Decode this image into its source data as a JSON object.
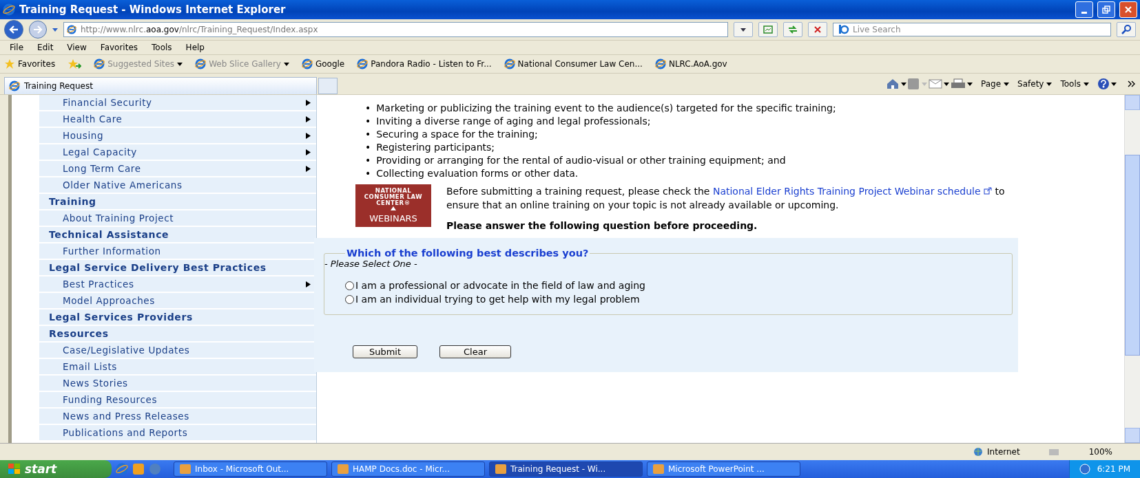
{
  "window": {
    "title": "Training Request - Windows Internet Explorer"
  },
  "address_bar": {
    "url": "http://www.nlrc.**aoa.gov**/nlrc/Training_Request/Index.aspx"
  },
  "search": {
    "placeholder": "Live Search"
  },
  "menu": [
    "File",
    "Edit",
    "View",
    "Favorites",
    "Tools",
    "Help"
  ],
  "favorites_bar": {
    "label": "Favorites",
    "links": [
      {
        "label": "Suggested Sites",
        "kind": "dropdown"
      },
      {
        "label": "Web Slice Gallery",
        "kind": "dropdown"
      },
      {
        "label": "Google",
        "kind": "link"
      },
      {
        "label": "Pandora Radio - Listen to Fr...",
        "kind": "link"
      },
      {
        "label": "National Consumer Law Cen...",
        "kind": "link"
      },
      {
        "label": "NLRC.AoA.gov",
        "kind": "link"
      }
    ]
  },
  "tabs": [
    {
      "label": "Training Request",
      "selected": true
    }
  ],
  "command_bar": [
    "Page",
    "Safety",
    "Tools"
  ],
  "sidebar": {
    "items": [
      {
        "label": "Financial Security",
        "kind": "sub",
        "submenu": true
      },
      {
        "label": "Health Care",
        "kind": "sub",
        "submenu": true
      },
      {
        "label": "Housing",
        "kind": "sub",
        "submenu": true
      },
      {
        "label": "Legal Capacity",
        "kind": "sub",
        "submenu": true
      },
      {
        "label": "Long Term Care",
        "kind": "sub",
        "submenu": true
      },
      {
        "label": "Older Native Americans",
        "kind": "sub",
        "submenu": false
      },
      {
        "label": "Training",
        "kind": "heading",
        "submenu": false
      },
      {
        "label": "About Training Project",
        "kind": "sub",
        "submenu": false
      },
      {
        "label": "Technical Assistance",
        "kind": "heading",
        "submenu": false
      },
      {
        "label": "Further Information",
        "kind": "sub",
        "submenu": false
      },
      {
        "label": "Legal Service Delivery Best Practices",
        "kind": "heading",
        "submenu": false
      },
      {
        "label": "Best Practices",
        "kind": "sub",
        "submenu": true
      },
      {
        "label": "Model Approaches",
        "kind": "sub",
        "submenu": false
      },
      {
        "label": "Legal Services Providers",
        "kind": "heading",
        "submenu": false
      },
      {
        "label": "Resources",
        "kind": "heading",
        "submenu": false
      },
      {
        "label": "Case/Legislative Updates",
        "kind": "sub",
        "submenu": false
      },
      {
        "label": "Email Lists",
        "kind": "sub",
        "submenu": false
      },
      {
        "label": "News Stories",
        "kind": "sub",
        "submenu": false
      },
      {
        "label": "Funding Resources",
        "kind": "sub",
        "submenu": false
      },
      {
        "label": "News and Press Releases",
        "kind": "sub",
        "submenu": false
      },
      {
        "label": "Publications and Reports",
        "kind": "sub",
        "submenu": false
      }
    ]
  },
  "content": {
    "bullets": [
      {
        "marker": "•",
        "text": "Marketing or publicizing the training event to the audience(s) targeted for the specific training;"
      },
      {
        "marker": "•",
        "text": "Inviting a diverse range of aging and legal professionals;"
      },
      {
        "marker": "•",
        "text": "Securing a space for the training;"
      },
      {
        "marker": "•",
        "text": "Registering participants;"
      },
      {
        "marker": "•",
        "text": "Providing or arranging for the rental of audio-visual or other training equipment; and"
      },
      {
        "marker": "•",
        "text": "Collecting evaluation forms or other data."
      }
    ],
    "logo": {
      "lines": [
        "NATIONAL",
        "CONSUMER LAW",
        "CENTER®"
      ],
      "caption": "WEBINARS"
    },
    "notice": {
      "before": "Before submitting a training request, please check the",
      "link": "National Elder Rights Training Project Webinar schedule",
      "after": "to ensure that an online training on your topic is not already available or upcoming."
    },
    "instruction": "Please answer the following question before proceeding.",
    "form": {
      "legend": "Which of the following best describes you?",
      "hint": "- Please Select One -",
      "options": [
        {
          "label": "I am a professional or advocate in the field of law and aging",
          "selected": false
        },
        {
          "label": "I am an individual trying to get help with my legal problem",
          "selected": false
        }
      ],
      "buttons": [
        "Submit",
        "Clear"
      ]
    }
  },
  "status_bar": {
    "zone": "Internet",
    "zoom": "100%"
  },
  "taskbar": {
    "start": "start",
    "tasks": [
      {
        "label": "Inbox - Microsoft Out...",
        "selected": false
      },
      {
        "label": "HAMP Docs.doc - Micr...",
        "selected": false
      },
      {
        "label": "Training Request - Wi...",
        "selected": true
      },
      {
        "label": "Microsoft PowerPoint ...",
        "selected": false
      }
    ],
    "clock": "6:21 PM"
  }
}
